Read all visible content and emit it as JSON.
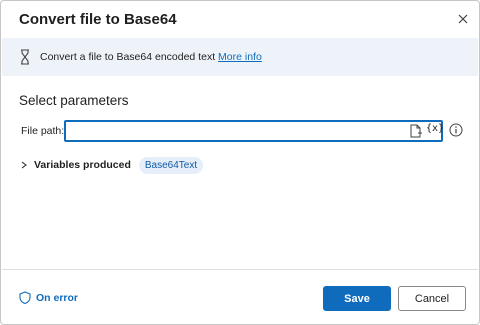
{
  "dialog": {
    "title": "Convert file to Base64",
    "close_icon": "close-icon"
  },
  "info": {
    "icon": "hourglass-icon",
    "text": "Convert a file to Base64 encoded text",
    "link": "More info"
  },
  "parameters": {
    "heading": "Select parameters",
    "file_path": {
      "label": "File path:",
      "value": "",
      "file_icon": "file-picker-icon",
      "variable_button": "{x}",
      "help_icon": "info-circle-icon"
    }
  },
  "variables": {
    "label": "Variables produced",
    "items": [
      "Base64Text"
    ]
  },
  "footer": {
    "on_error": "On error",
    "save": "Save",
    "cancel": "Cancel"
  },
  "colors": {
    "accent": "#0f6cbd",
    "info_bg": "#eef3fa",
    "pill_bg": "#e6eef9"
  }
}
